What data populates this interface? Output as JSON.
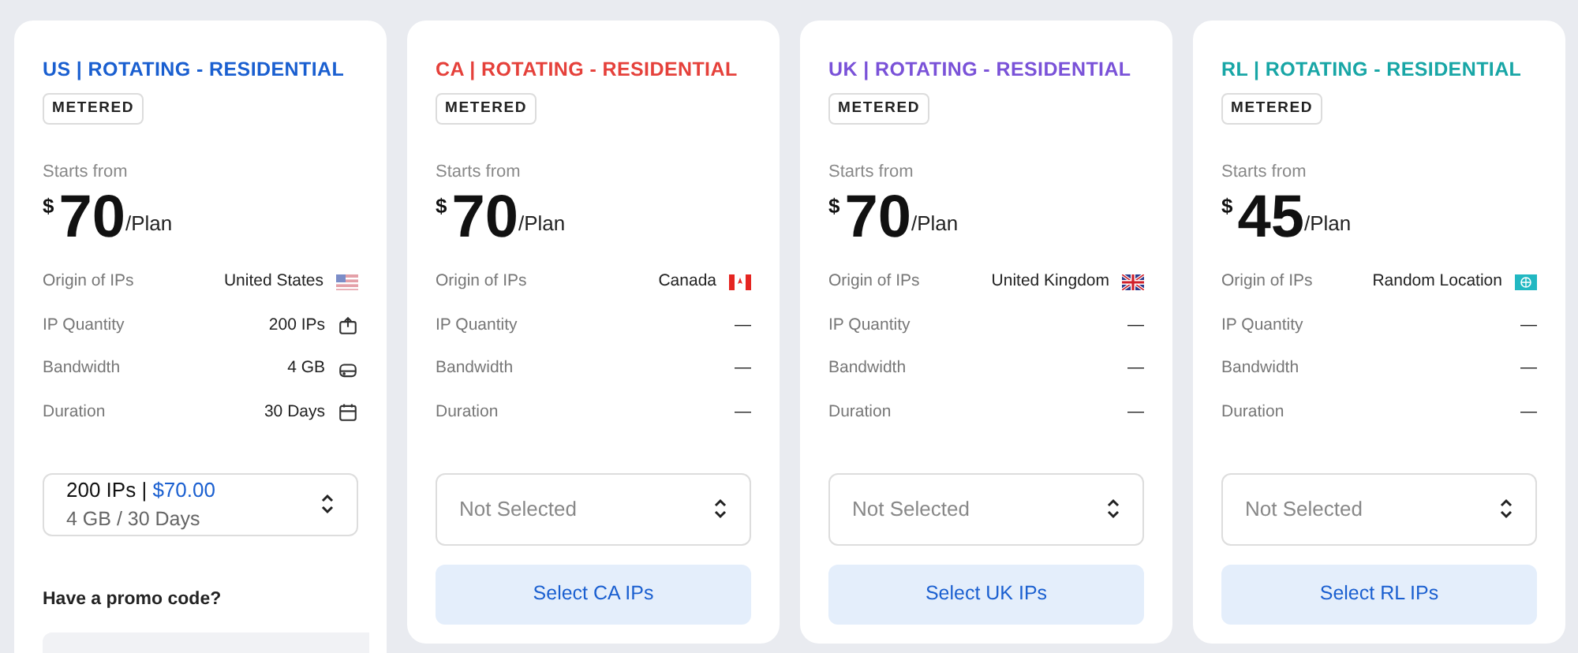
{
  "plans": [
    {
      "title": "US | ROTATING - RESIDENTIAL",
      "color": "#1a5fd0",
      "badge": "METERED",
      "starts_label": "Starts from",
      "currency": "$",
      "price": "70",
      "unit": "/Plan",
      "details": [
        {
          "label": "Origin of IPs",
          "value": "United States"
        },
        {
          "label": "IP Quantity",
          "value": "200 IPs"
        },
        {
          "label": "Bandwidth",
          "value": "4 GB"
        },
        {
          "label": "Duration",
          "value": "30 Days"
        }
      ],
      "select": {
        "kind": "value",
        "main": "200 IPs |",
        "price": "$70.00",
        "sub": "4 GB / 30 Days"
      },
      "promo": {
        "label": "Have a promo code?"
      }
    },
    {
      "title": "CA | ROTATING - RESIDENTIAL",
      "color": "#e5413b",
      "badge": "METERED",
      "starts_label": "Starts from",
      "currency": "$",
      "price": "70",
      "unit": "/Plan",
      "details": [
        {
          "label": "Origin of IPs",
          "value": "Canada"
        },
        {
          "label": "IP Quantity",
          "value": "—"
        },
        {
          "label": "Bandwidth",
          "value": "—"
        },
        {
          "label": "Duration",
          "value": "—"
        }
      ],
      "select": {
        "kind": "placeholder",
        "placeholder": "Not Selected"
      },
      "button": "Select CA IPs"
    },
    {
      "title": "UK | ROTATING - RESIDENTIAL",
      "color": "#7a52d8",
      "badge": "METERED",
      "starts_label": "Starts from",
      "currency": "$",
      "price": "70",
      "unit": "/Plan",
      "details": [
        {
          "label": "Origin of IPs",
          "value": "United Kingdom"
        },
        {
          "label": "IP Quantity",
          "value": "—"
        },
        {
          "label": "Bandwidth",
          "value": "—"
        },
        {
          "label": "Duration",
          "value": "—"
        }
      ],
      "select": {
        "kind": "placeholder",
        "placeholder": "Not Selected"
      },
      "button": "Select UK IPs"
    },
    {
      "title": "RL | ROTATING - RESIDENTIAL",
      "color": "#18a6a6",
      "badge": "METERED",
      "starts_label": "Starts from",
      "currency": "$",
      "price": "45",
      "unit": "/Plan",
      "details": [
        {
          "label": "Origin of IPs",
          "value": "Random Location"
        },
        {
          "label": "IP Quantity",
          "value": "—"
        },
        {
          "label": "Bandwidth",
          "value": "—"
        },
        {
          "label": "Duration",
          "value": "—"
        }
      ],
      "select": {
        "kind": "placeholder",
        "placeholder": "Not Selected"
      },
      "button": "Select RL IPs"
    }
  ]
}
